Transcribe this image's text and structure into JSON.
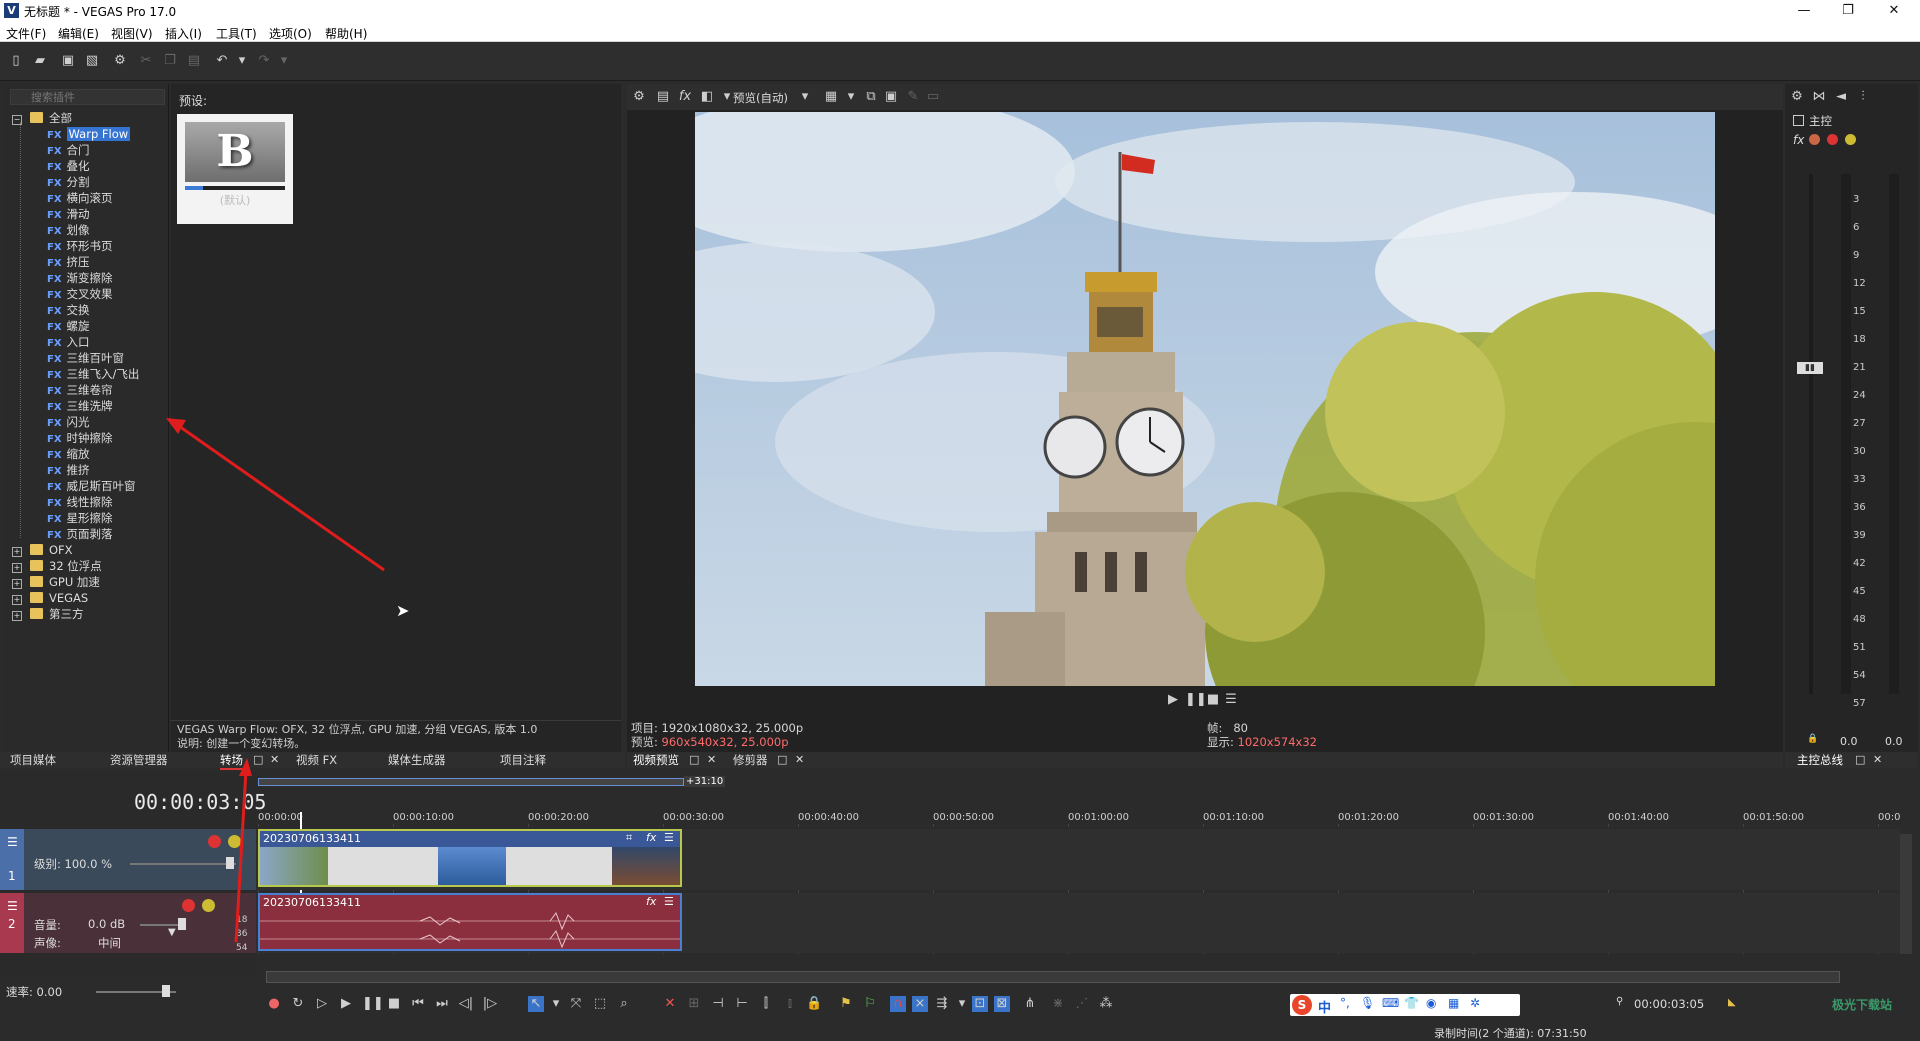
{
  "window": {
    "title": "无标题 * - VEGAS Pro 17.0",
    "app_icon": "V",
    "controls": [
      "—",
      "❐",
      "✕"
    ]
  },
  "menu": [
    "文件(F)",
    "编辑(E)",
    "视图(V)",
    "插入(I)",
    "工具(T)",
    "选项(O)",
    "帮助(H)"
  ],
  "plugins": {
    "search_placeholder": "搜索插件",
    "root": "全部",
    "fx_tag": "FX",
    "items": [
      "Warp Flow",
      "合门",
      "叠化",
      "分割",
      "横向滚页",
      "滑动",
      "划像",
      "环形书页",
      "挤压",
      "渐变擦除",
      "交叉效果",
      "交换",
      "螺旋",
      "入口",
      "三维百叶窗",
      "三维飞入/飞出",
      "三维卷帘",
      "三维洗牌",
      "闪光",
      "时钟擦除",
      "缩放",
      "推挤",
      "威尼斯百叶窗",
      "线性擦除",
      "星形擦除",
      "页面剥落"
    ],
    "groups": [
      "OFX",
      "32 位浮点",
      "GPU 加速",
      "VEGAS",
      "第三方"
    ]
  },
  "presets": {
    "label": "预设:",
    "thumb_letter": "B",
    "name": "(默认)",
    "desc_line1": "VEGAS Warp Flow: OFX, 32 位浮点, GPU 加速, 分组 VEGAS, 版本 1.0",
    "desc_line2": "说明: 创建一个变幻转场。"
  },
  "left_tabs": [
    "项目媒体",
    "资源管理器",
    "转场",
    "视频 FX",
    "媒体生成器",
    "项目注释"
  ],
  "preview": {
    "mode": "预览(自动)",
    "project_label": "项目:",
    "project_value": "1920x1080x32, 25.000p",
    "preview_label": "预览:",
    "preview_value": "960x540x32, 25.000p",
    "frame_label": "帧:",
    "frame_value": "80",
    "display_label": "显示:",
    "display_value": "1020x574x32",
    "tabs": [
      "视频预览",
      "修剪器"
    ]
  },
  "master": {
    "title": "主控",
    "scale": [
      "3",
      "6",
      "9",
      "12",
      "15",
      "18",
      "21",
      "24",
      "27",
      "30",
      "33",
      "36",
      "39",
      "42",
      "45",
      "48",
      "51",
      "54",
      "57"
    ],
    "left_value": "0.0",
    "right_value": "0.0",
    "tab": "主控总线"
  },
  "timeline": {
    "time": "00:00:03:05",
    "selection_length": "+31:10",
    "ruler": [
      "00:00:00",
      "00:00:10:00",
      "00:00:20:00",
      "00:00:30:00",
      "00:00:40:00",
      "00:00:50:00",
      "00:01:00:00",
      "00:01:10:00",
      "00:01:20:00",
      "00:01:30:00",
      "00:01:40:00",
      "00:01:50:00",
      "00:0"
    ],
    "track1": {
      "num": "1",
      "level_label": "级别: 100.0 %",
      "clip": "20230706133411"
    },
    "track2": {
      "num": "2",
      "vol_label": "音量:",
      "vol_value": "0.0 dB",
      "pan_label": "声像:",
      "pan_value": "中间",
      "clip": "20230706133411",
      "db_scale": [
        "18",
        "36",
        "54"
      ]
    },
    "rate_label": "速率: 0.00",
    "cursor_time": "00:00:03:05",
    "record_time": "录制时间(2 个通道): 07:31:50",
    "watermark": "极光下载站"
  },
  "ime": {
    "logo": "S",
    "label": "中"
  }
}
